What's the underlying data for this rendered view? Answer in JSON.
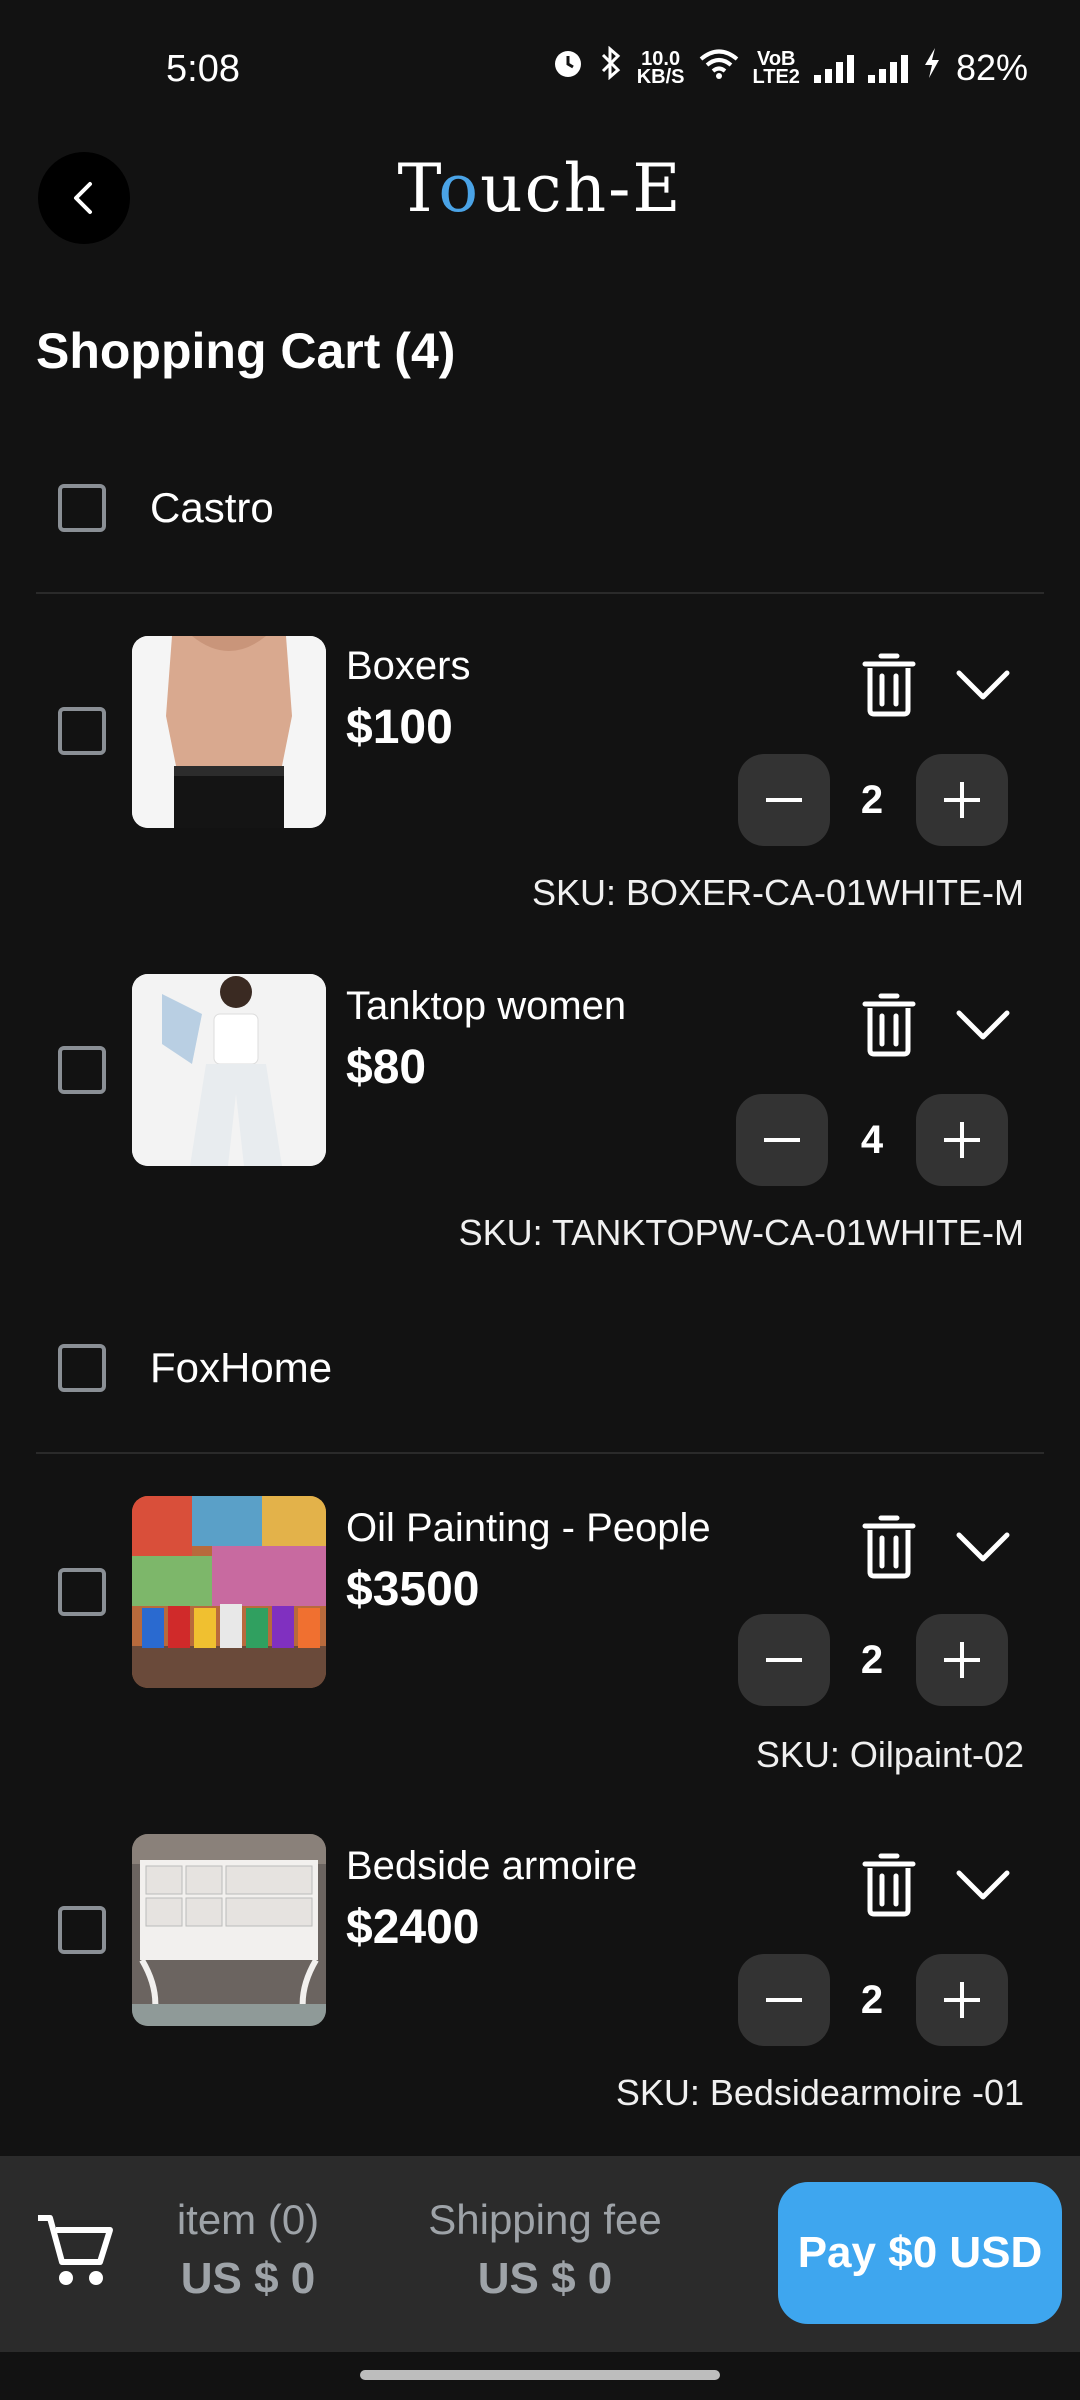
{
  "status": {
    "time": "5:08",
    "net_speed_top": "10.0",
    "net_speed_bottom": "KB/S",
    "volte_top": "VoB",
    "volte_bottom": "LTE2",
    "battery": "82%"
  },
  "app": {
    "logo_left": "T",
    "logo_o": "o",
    "logo_right": "uch-E"
  },
  "title": "Shopping Cart (4)",
  "stores": [
    {
      "name": "Castro"
    },
    {
      "name": "FoxHome"
    }
  ],
  "items": [
    {
      "name": "Boxers",
      "price": "$100",
      "qty": "2",
      "sku": "SKU: BOXER-CA-01WHITE-M"
    },
    {
      "name": "Tanktop women",
      "price": "$80",
      "qty": "4",
      "sku": "SKU: TANKTOPW-CA-01WHITE-M"
    },
    {
      "name": "Oil Painting  - People",
      "price": "$3500",
      "qty": "2",
      "sku": "SKU: Oilpaint-02"
    },
    {
      "name": "Bedside armoire",
      "price": "$2400",
      "qty": "2",
      "sku": "SKU: Bedsidearmoire -01"
    }
  ],
  "footer": {
    "items_label": "item (0)",
    "items_value": "US $ 0",
    "shipping_label": "Shipping fee",
    "shipping_value": "US $ 0",
    "pay_label": "Pay $0 USD"
  },
  "colors": {
    "accent": "#3ea6ef",
    "background": "#121212",
    "bottom_bar": "#2b2b2b",
    "qty_button": "#333333"
  },
  "icons": [
    "alarm-icon",
    "bluetooth-icon",
    "wifi-icon",
    "signal-icon",
    "battery-charging-icon",
    "back-arrow-icon",
    "trash-icon",
    "chevron-down-icon",
    "minus-icon",
    "plus-icon",
    "cart-icon"
  ]
}
